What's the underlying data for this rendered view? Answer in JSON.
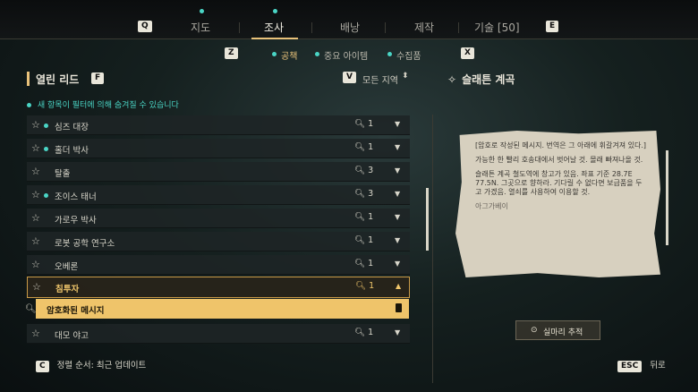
{
  "top_nav": {
    "prev_key": "Q",
    "next_key": "E",
    "tabs": [
      {
        "label": "지도",
        "has_dot": true
      },
      {
        "label": "조사",
        "has_dot": true
      },
      {
        "label": "배낭",
        "has_dot": false
      },
      {
        "label": "제작",
        "has_dot": false
      },
      {
        "label": "기술 [50]",
        "has_dot": false
      }
    ],
    "active_tab": "조사"
  },
  "sub_nav": {
    "prev_key": "Z",
    "next_key": "X",
    "tabs": [
      "공책",
      "중요 아이템",
      "수집품"
    ],
    "active": "공책"
  },
  "left_panel": {
    "title": "열린 리드",
    "filter_key": "F",
    "region_key": "V",
    "region_filter": "모든 지역",
    "hidden_note": "새 항목이 필터에 의해 숨겨질 수 있습니다",
    "leads": [
      {
        "name": "심즈 대장",
        "new": true,
        "clues": "1"
      },
      {
        "name": "홀더 박사",
        "new": true,
        "clues": "1"
      },
      {
        "name": "탈출",
        "new": false,
        "clues": "3"
      },
      {
        "name": "조이스 태너",
        "new": true,
        "clues": "3"
      },
      {
        "name": "가로우 박사",
        "new": false,
        "clues": "1"
      },
      {
        "name": "로봇 공학 연구소",
        "new": false,
        "clues": "1"
      },
      {
        "name": "오베론",
        "new": false,
        "clues": "1"
      },
      {
        "name": "침투자",
        "new": false,
        "clues": "1",
        "selected": true
      },
      {
        "name": "대모 야고",
        "new": false,
        "clues": "1"
      }
    ],
    "expanded_clue": "암호화된 메시지"
  },
  "right_panel": {
    "title": "슬래튼 계곡",
    "note_paragraphs": [
      "[암호로 작성된 메시지. 번역은 그 아래에 휘갈겨져 있다.]",
      "가능한 한 빨리 호송대에서 벗어날 것. 몰래 빠져나올 것.",
      "슬래튼 계곡 철도역에 창고가 있음. 좌표 기준 28.7E 77.5N. 그곳으로 향하라. 기다릴 수 없다면 보급품을 두고 가겠음. 열쇠를 사용하여 이용할 것."
    ],
    "note_signature": "아그가베이",
    "track_button": "실마리 추적"
  },
  "footer": {
    "sort_key": "C",
    "sort_label": "정렬 순서: 최근 업데이트",
    "back_key": "ESC",
    "back_label": "뒤로"
  }
}
